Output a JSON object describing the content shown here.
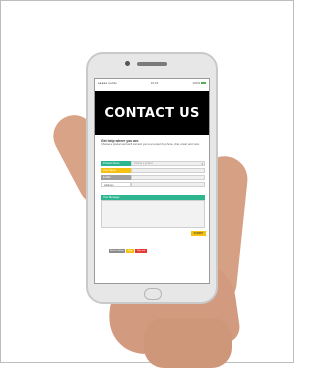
{
  "status_bar": {
    "carrier": "●●●●● mobile",
    "time": "16:15",
    "battery": "100%"
  },
  "banner_title": "CONTACT US",
  "help_heading": "Get help where you are.",
  "help_description": "Choose a product and we'll connect you to an expert by phone, chat, email, and more.",
  "form": {
    "rows": [
      {
        "label": "Product Name",
        "value": "Choose a product",
        "label_color": "#2cb58e"
      },
      {
        "label": "Your Name",
        "value": "",
        "label_color": "#f5c211"
      },
      {
        "label": "E-Mail",
        "value": "",
        "label_color": "#9e9e9e"
      },
      {
        "label": "Address",
        "value": "",
        "label_color": "#ffffff"
      }
    ],
    "message_label": "Your Message",
    "submit_label": "SUBMIT"
  },
  "bottom_buttons": [
    {
      "label": "Back to Home",
      "color": "#8c8c8c"
    },
    {
      "label": "Help",
      "color": "#f5c211"
    },
    {
      "label": "Sign out",
      "color": "#e53935"
    }
  ],
  "colors": {
    "accent": "#2cb58e",
    "highlight": "#f5c211",
    "banner": "#000000"
  }
}
